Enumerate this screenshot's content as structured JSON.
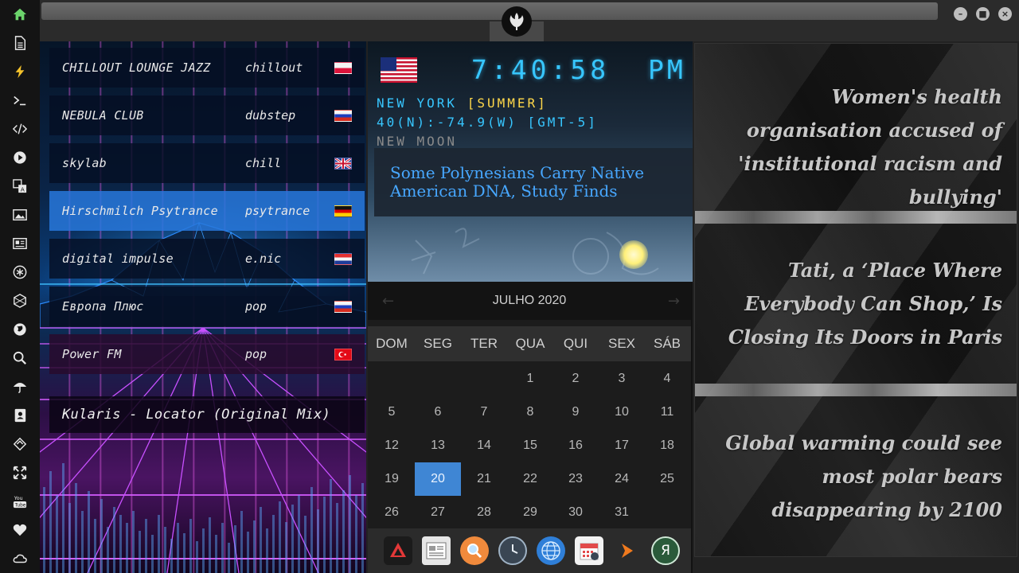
{
  "sidebar": {
    "icons": [
      "home-icon",
      "document-icon",
      "lightning-icon",
      "terminal-icon",
      "code-icon",
      "play-icon",
      "translate-icon",
      "image-icon",
      "news-icon",
      "asterisk-icon",
      "hexagon-icon",
      "globe-icon",
      "search-icon",
      "umbrella-icon",
      "contacts-icon",
      "tag-icon",
      "expand-icon",
      "youtube-icon",
      "heart-icon",
      "cloud-icon"
    ]
  },
  "titlebar": {
    "logo": "rebel-alliance-icon"
  },
  "radio": {
    "stations": [
      {
        "name": "CHILLOUT LOUNGE JAZZ",
        "genre": "chillout",
        "flag": "poland"
      },
      {
        "name": "NEBULA CLUB",
        "genre": "dubstep",
        "flag": "russia"
      },
      {
        "name": "skylab",
        "genre": "chill",
        "flag": "uk"
      },
      {
        "name": "Hirschmilch Psytrance",
        "genre": "psytrance",
        "flag": "germany"
      },
      {
        "name": "digital impulse",
        "genre": "e.nic",
        "flag": "croatia"
      },
      {
        "name": "Европа Плюс",
        "genre": "pop",
        "flag": "russia"
      },
      {
        "name": "Power FM",
        "genre": "pop",
        "flag": "turkey"
      }
    ],
    "now_playing": "Kularis - Locator (Original Mix)"
  },
  "clock": {
    "time": "7:40:58",
    "ampm": "PM",
    "location": "NEW YORK",
    "dst": "[SUMMER]",
    "coords": "40(N):-74.9(W) [GMT-5]",
    "moon": "NEW MOON",
    "news": "Some Polynesians Carry Native American DNA, Study Finds"
  },
  "calendar": {
    "month": "JULHO 2020",
    "weekdays": [
      "DOM",
      "SEG",
      "TER",
      "QUA",
      "QUI",
      "SEX",
      "SÁB"
    ],
    "weeks": [
      [
        "",
        "",
        "",
        "1",
        "2",
        "3",
        "4"
      ],
      [
        "5",
        "6",
        "7",
        "8",
        "9",
        "10",
        "11"
      ],
      [
        "12",
        "13",
        "14",
        "15",
        "16",
        "17",
        "18"
      ],
      [
        "19",
        "20",
        "21",
        "22",
        "23",
        "24",
        "25"
      ],
      [
        "26",
        "27",
        "28",
        "29",
        "30",
        "31",
        ""
      ]
    ],
    "today": "20"
  },
  "dock": {
    "apps": [
      "anydesk-icon",
      "news-reader-icon",
      "search-icon",
      "clock-icon",
      "globe-icon",
      "calendar-icon",
      "arrow-icon",
      "yandex-icon"
    ]
  },
  "news": {
    "headlines": [
      "Women's health organisation accused of 'institutional racism and bullying'",
      "Tati, a ‘Place Where Everybody Can Shop,’ Is Closing Its Doors in Paris",
      "Global warming could see most polar bears disappearing by 2100"
    ]
  }
}
